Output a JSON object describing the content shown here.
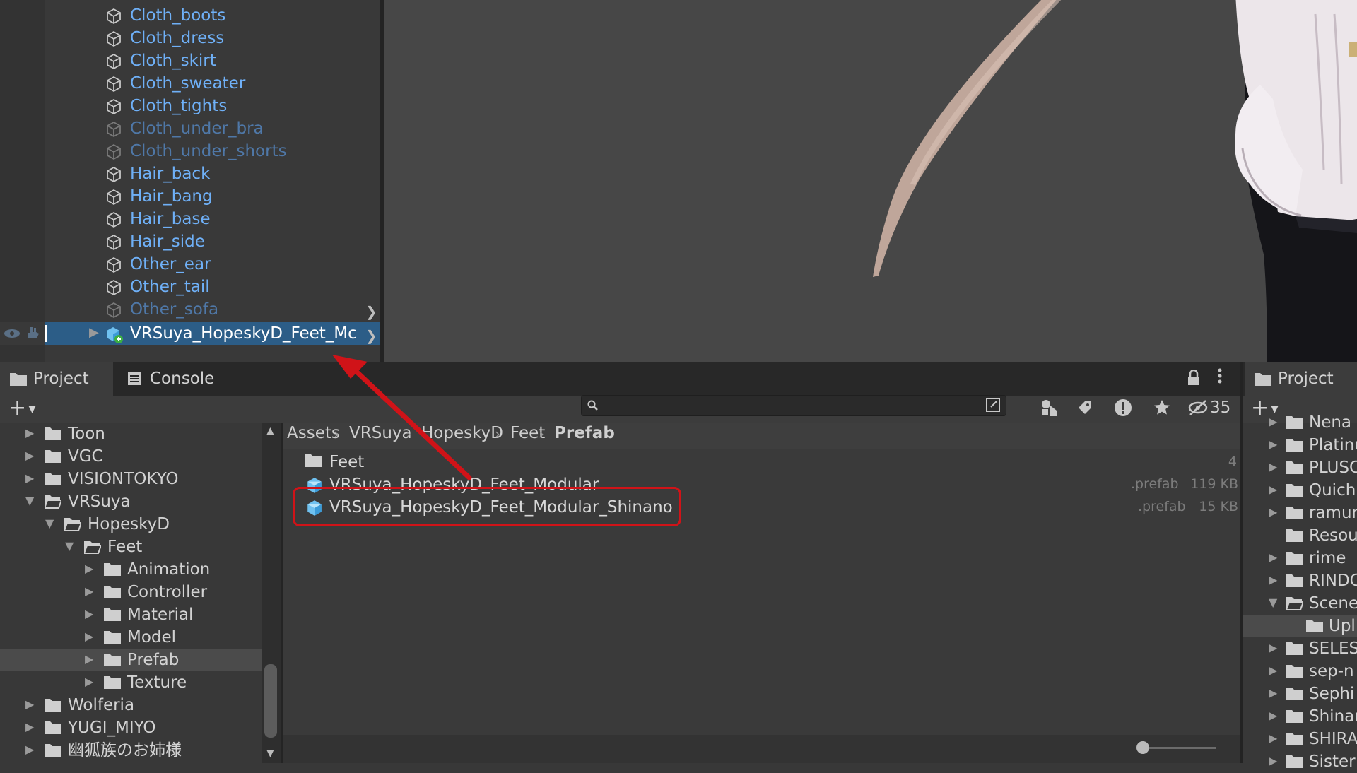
{
  "hierarchy": {
    "items": [
      {
        "label": "Cloth_boots",
        "dim": false
      },
      {
        "label": "Cloth_dress",
        "dim": false
      },
      {
        "label": "Cloth_skirt",
        "dim": false
      },
      {
        "label": "Cloth_sweater",
        "dim": false
      },
      {
        "label": "Cloth_tights",
        "dim": false
      },
      {
        "label": "Cloth_under_bra",
        "dim": true
      },
      {
        "label": "Cloth_under_shorts",
        "dim": true
      },
      {
        "label": "Hair_back",
        "dim": false
      },
      {
        "label": "Hair_bang",
        "dim": false
      },
      {
        "label": "Hair_base",
        "dim": false
      },
      {
        "label": "Hair_side",
        "dim": false
      },
      {
        "label": "Other_ear",
        "dim": false
      },
      {
        "label": "Other_tail",
        "dim": false
      },
      {
        "label": "Other_sofa",
        "dim": true
      }
    ],
    "selected_item": "VRSuya_HopeskyD_Feet_Mc"
  },
  "tabs": {
    "project": "Project",
    "console": "Console",
    "right_project": "Project"
  },
  "toolbar": {
    "add_label": "+",
    "search_placeholder": "",
    "hidden_count": "35"
  },
  "breadcrumb": [
    "Assets",
    "VRSuya",
    "HopeskyD",
    "Feet",
    "Prefab"
  ],
  "tree": [
    {
      "label": "Toon",
      "depth": 0,
      "expanded": false
    },
    {
      "label": "VGC",
      "depth": 0,
      "expanded": false
    },
    {
      "label": "VISIONTOKYO",
      "depth": 0,
      "expanded": false
    },
    {
      "label": "VRSuya",
      "depth": 0,
      "expanded": true
    },
    {
      "label": "HopeskyD",
      "depth": 1,
      "expanded": true
    },
    {
      "label": "Feet",
      "depth": 2,
      "expanded": true
    },
    {
      "label": "Animation",
      "depth": 3,
      "expanded": false
    },
    {
      "label": "Controller",
      "depth": 3,
      "expanded": false
    },
    {
      "label": "Material",
      "depth": 3,
      "expanded": false
    },
    {
      "label": "Model",
      "depth": 3,
      "expanded": false
    },
    {
      "label": "Prefab",
      "depth": 3,
      "expanded": false,
      "selected": true
    },
    {
      "label": "Texture",
      "depth": 3,
      "expanded": false
    },
    {
      "label": "Wolferia",
      "depth": 0,
      "expanded": false
    },
    {
      "label": "YUGI_MIYO",
      "depth": 0,
      "expanded": false
    },
    {
      "label": "幽狐族のお姉様",
      "depth": 0,
      "expanded": false
    }
  ],
  "files": [
    {
      "name": "Feet",
      "type": "folder",
      "ext": "",
      "size": "4"
    },
    {
      "name": "VRSuya_HopeskyD_Feet_Modular",
      "type": "prefab",
      "ext": ".prefab",
      "size": "119 KB"
    },
    {
      "name": "VRSuya_HopeskyD_Feet_Modular_Shinano",
      "type": "prefab",
      "ext": ".prefab",
      "size": "15 KB"
    }
  ],
  "right_tree": [
    {
      "label": "Nena",
      "expanded": false
    },
    {
      "label": "Platinu",
      "expanded": false
    },
    {
      "label": "PLUSC",
      "expanded": false
    },
    {
      "label": "Quich",
      "expanded": false
    },
    {
      "label": "ramun",
      "expanded": false
    },
    {
      "label": "Resou",
      "expanded": null
    },
    {
      "label": "rime",
      "expanded": false
    },
    {
      "label": "RINDC",
      "expanded": false
    },
    {
      "label": "Scene",
      "expanded": true
    },
    {
      "label": "Upl",
      "expanded": null,
      "selected": true,
      "child": true
    },
    {
      "label": "SELES",
      "expanded": false
    },
    {
      "label": "sep-n",
      "expanded": false
    },
    {
      "label": "Sephi",
      "expanded": false
    },
    {
      "label": "Shinar",
      "expanded": false
    },
    {
      "label": "SHIRA",
      "expanded": false
    },
    {
      "label": "Sister",
      "expanded": false
    }
  ],
  "colors": {
    "highlight": "#d01318",
    "link_blue": "#6fb0f7",
    "selection": "#2c5d87"
  }
}
